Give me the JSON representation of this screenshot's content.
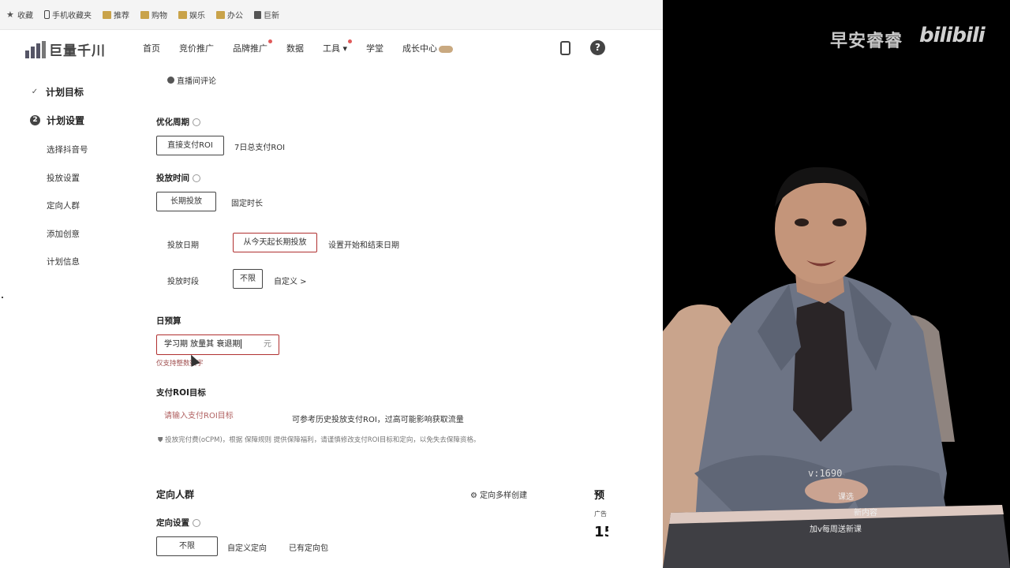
{
  "bookmarks": [
    {
      "icon": "star-icon",
      "label": "收藏"
    },
    {
      "icon": "phone-icon",
      "label": "手机收藏夹"
    },
    {
      "icon": "folder-icon",
      "label": "推荐"
    },
    {
      "icon": "folder-icon",
      "label": "购物"
    },
    {
      "icon": "folder-icon",
      "label": "娱乐"
    },
    {
      "icon": "folder-icon",
      "label": "办公"
    },
    {
      "icon": "doc-icon",
      "label": "巨新"
    }
  ],
  "brand": {
    "name": "巨量千川"
  },
  "nav": {
    "items": [
      "首页",
      "竞价推广",
      "品牌推广",
      "数据",
      "工具 ▾",
      "学堂",
      "成长中心"
    ],
    "dot_items": [
      2,
      4
    ]
  },
  "sidebar": {
    "steps": [
      {
        "label": "计划目标",
        "state": "done"
      },
      {
        "label": "计划设置",
        "state": "current",
        "num": "2"
      }
    ],
    "subs": [
      "选择抖音号",
      "投放设置",
      "定向人群",
      "添加创意",
      "计划信息"
    ]
  },
  "form": {
    "comment_chip": "直播间评论",
    "cycle": {
      "label": "优化周期",
      "selected": "直接支付ROI",
      "other": "7日总支付ROI"
    },
    "time": {
      "label": "投放时间",
      "selected": "长期投放",
      "other": "固定时长"
    },
    "date": {
      "label": "投放日期",
      "selected": "从今天起长期投放",
      "other": "设置开始和结束日期"
    },
    "period": {
      "label": "投放时段",
      "selected": "不限",
      "other": "自定义 >"
    },
    "budget": {
      "label": "日预算",
      "value": "学习期  放量其  衰退期",
      "unit": "元",
      "hint": "仅支持整数数字"
    },
    "roi": {
      "label": "支付ROI目标",
      "placeholder": "请输入支付ROI目标",
      "tip": "可参考历史投放支付ROI，过高可能影响获取流量",
      "note": "投放完付费(oCPM)，根据 保障规则 提供保障福利，请谨慎修改支付ROI目标和定向，以免失去保障资格。"
    },
    "audience": {
      "title": "定向人群",
      "multi": "定向多样创建",
      "setting_label": "定向设置",
      "selected": "不限",
      "custom": "自定义定向",
      "existing": "已有定向包"
    },
    "preview": {
      "title": "预",
      "sub": "广告",
      "num": "15"
    }
  },
  "video": {
    "channel": "早安睿睿",
    "platform": "bilibili",
    "watermark_id": "v:1690",
    "watermark_lines": [
      "课选",
      "新内容",
      "加v每周送新课"
    ]
  }
}
